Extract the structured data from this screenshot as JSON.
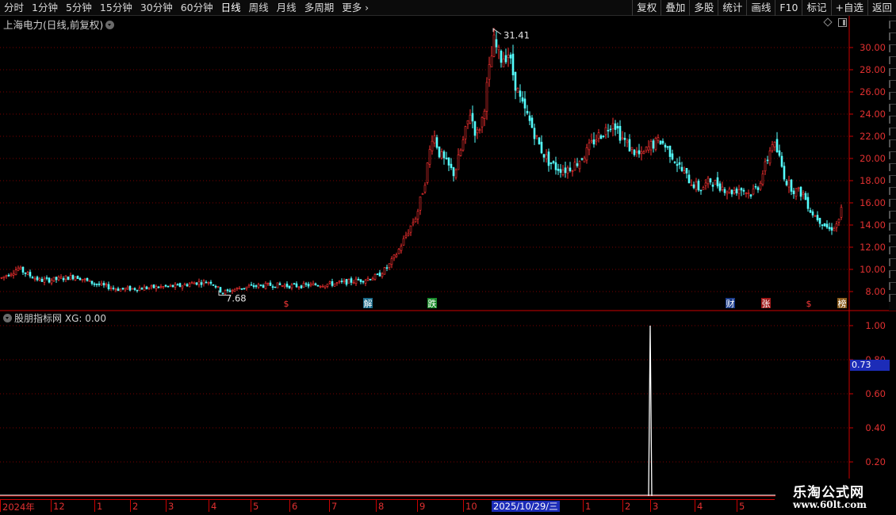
{
  "toolbar": {
    "period_tabs": [
      "分时",
      "1分钟",
      "5分钟",
      "15分钟",
      "30分钟",
      "60分钟",
      "日线",
      "周线",
      "月线",
      "多周期",
      "更多"
    ],
    "active_tab_index": 6,
    "right_buttons": [
      "复权",
      "叠加",
      "多股",
      "统计",
      "画线",
      "F10",
      "标记",
      "+自选",
      "返回"
    ]
  },
  "chart": {
    "title": "上海电力(日线,前复权)",
    "high_label": "31.41",
    "low_label": "7.68",
    "price_axis_labels": [
      "30.00",
      "28.00",
      "26.00",
      "24.00",
      "22.00",
      "20.00",
      "18.00",
      "16.00",
      "14.00",
      "12.00",
      "10.00",
      "8.00"
    ],
    "event_markers": [
      {
        "label": "$",
        "color": "#ff3a3a",
        "bg": "#000000"
      },
      {
        "label": "解",
        "color": "#ffffff",
        "bg": "#1a6a8a"
      },
      {
        "label": "跌",
        "color": "#ffffff",
        "bg": "#1a8a2a"
      },
      {
        "label": "财",
        "color": "#ffffff",
        "bg": "#1a3a8a"
      },
      {
        "label": "张",
        "color": "#ffffff",
        "bg": "#a01818"
      },
      {
        "label": "$",
        "color": "#ff3a3a",
        "bg": "#000000"
      },
      {
        "label": "榜",
        "color": "#ffffff",
        "bg": "#8a5a1a"
      }
    ],
    "up_color": "#ff3232",
    "down_color": "#54ffff"
  },
  "chart_data": {
    "type": "candlestick",
    "note_range": "daily candles, 2024 to 2026",
    "ylim": [
      7.2,
      32
    ],
    "high": 31.41,
    "low": 7.68,
    "close_path": [
      [
        0,
        9.2
      ],
      [
        10,
        9.6
      ],
      [
        22,
        10.1
      ],
      [
        35,
        9.5
      ],
      [
        50,
        9.0
      ],
      [
        70,
        9.1
      ],
      [
        95,
        9.4
      ],
      [
        110,
        8.9
      ],
      [
        130,
        8.5
      ],
      [
        150,
        8.2
      ],
      [
        175,
        8.3
      ],
      [
        200,
        8.4
      ],
      [
        225,
        8.5
      ],
      [
        245,
        8.8
      ],
      [
        265,
        8.9
      ],
      [
        280,
        7.9
      ],
      [
        300,
        8.3
      ],
      [
        320,
        8.5
      ],
      [
        345,
        8.6
      ],
      [
        370,
        8.5
      ],
      [
        395,
        8.6
      ],
      [
        420,
        8.7
      ],
      [
        440,
        8.9
      ],
      [
        460,
        9.1
      ],
      [
        475,
        9.4
      ],
      [
        488,
        10.2
      ],
      [
        500,
        11.5
      ],
      [
        512,
        13.2
      ],
      [
        525,
        15.0
      ],
      [
        535,
        18.0
      ],
      [
        545,
        22.5
      ],
      [
        553,
        20.5
      ],
      [
        562,
        19.5
      ],
      [
        572,
        18.6
      ],
      [
        583,
        21.5
      ],
      [
        592,
        24.2
      ],
      [
        600,
        22.0
      ],
      [
        608,
        23.8
      ],
      [
        615,
        27.5
      ],
      [
        622,
        30.5
      ],
      [
        630,
        29.0
      ],
      [
        640,
        29.5
      ],
      [
        648,
        27.0
      ],
      [
        656,
        25.0
      ],
      [
        664,
        23.8
      ],
      [
        672,
        22.5
      ],
      [
        680,
        21.0
      ],
      [
        690,
        19.8
      ],
      [
        700,
        19.2
      ],
      [
        712,
        19.0
      ],
      [
        725,
        19.5
      ],
      [
        738,
        20.5
      ],
      [
        750,
        21.8
      ],
      [
        762,
        22.5
      ],
      [
        772,
        23.5
      ],
      [
        782,
        22.0
      ],
      [
        795,
        20.8
      ],
      [
        808,
        20.2
      ],
      [
        820,
        21.2
      ],
      [
        832,
        21.6
      ],
      [
        845,
        20.5
      ],
      [
        858,
        19.0
      ],
      [
        870,
        17.9
      ],
      [
        882,
        17.2
      ],
      [
        895,
        18.0
      ],
      [
        908,
        17.5
      ],
      [
        920,
        17.0
      ],
      [
        933,
        17.3
      ],
      [
        945,
        16.8
      ],
      [
        955,
        17.5
      ],
      [
        965,
        19.5
      ],
      [
        973,
        21.5
      ],
      [
        980,
        20.5
      ],
      [
        990,
        18.0
      ],
      [
        1000,
        17.2
      ],
      [
        1012,
        16.8
      ],
      [
        1022,
        15.2
      ],
      [
        1035,
        14.3
      ],
      [
        1045,
        13.6
      ],
      [
        1055,
        14.1
      ],
      [
        1062,
        15.8
      ]
    ],
    "indicator": {
      "name": "股朋指标网",
      "series_label": "XG",
      "current_value": "0.00",
      "axis_labels": [
        "1.00",
        "0.80",
        "0.60",
        "0.40",
        "0.20"
      ],
      "ylim": [
        0,
        1.05
      ],
      "cursor_value": "0.73",
      "signal_x_date": "2026-03 start",
      "signal_value": 1.0
    },
    "date_axis": {
      "labels": [
        "2024年",
        "12",
        "1",
        "2",
        "3",
        "4",
        "5",
        "6",
        "7",
        "8",
        "9",
        "10",
        "11",
        "12",
        "1",
        "2",
        "3",
        "4",
        "5"
      ],
      "cursor_date": "2025/10/29/三"
    }
  },
  "watermark": {
    "title": "乐淘公式网",
    "url": "www.60lt.com"
  }
}
